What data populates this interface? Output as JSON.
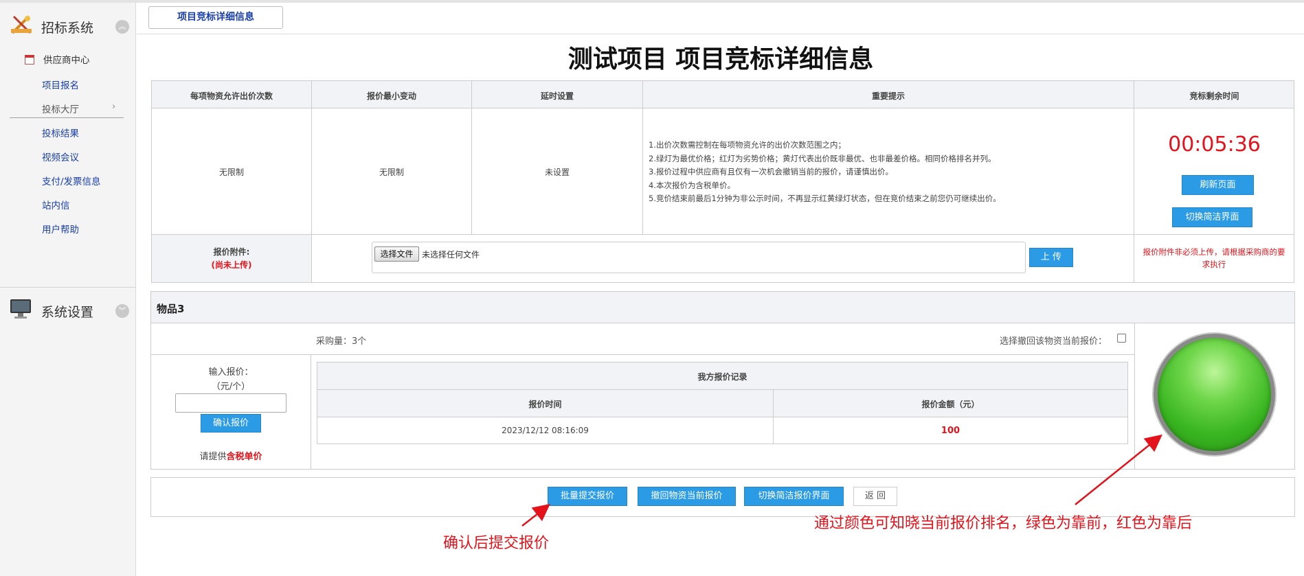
{
  "sidebar": {
    "header1": "招标系统",
    "sub_header": "供应商中心",
    "items": [
      "项目报名",
      "投标大厅",
      "投标结果",
      "视频会议",
      "支付/发票信息",
      "站内信",
      "用户帮助"
    ],
    "header2": "系统设置"
  },
  "tab": {
    "label": "项目竞标详细信息"
  },
  "page_title": "测试项目 项目竞标详细信息",
  "info_table": {
    "headers": [
      "每项物资允许出价次数",
      "报价最小变动",
      "延时设置",
      "重要提示",
      "竞标剩余时间"
    ],
    "values": [
      "无限制",
      "无限制",
      "未设置"
    ],
    "notes": [
      "1.出价次数需控制在每项物资允许的出价次数范围之内；",
      "2.绿灯为最优价格；红灯为劣势价格；黄灯代表出价既非最优、也非最差价格。相同价格排名并列。",
      "3.报价过程中供应商有且仅有一次机会撤销当前的报价，请谨慎出价。",
      "4.本次报价为含税单价。",
      "5.竞价结束前最后1分钟为非公示时间，不再显示红黄绿灯状态，但在竞价结束之前您仍可继续出价。"
    ],
    "timer": "00:05:36",
    "refresh_btn": "刷新页面",
    "switch_btn": "切换简洁界面"
  },
  "attachment": {
    "label": "报价附件:",
    "status": "(尚未上传)",
    "file_btn": "选择文件",
    "file_none": "未选择任何文件",
    "upload_btn": "上 传",
    "hint": "报价附件非必须上传，请根据采购商的要求执行"
  },
  "item": {
    "name": "物品3",
    "quantity": "采购量：3个",
    "withdraw_label": "选择撤回该物资当前报价：",
    "withdraw_checked": false,
    "input_label": "输入报价：",
    "input_unit": "（元/个）",
    "input_value": "",
    "confirm_btn": "确认报价",
    "tip_prefix": "请提供",
    "tip_emph": "含税单价",
    "record_title": "我方报价记录",
    "record_headers": [
      "报价时间",
      "报价金额（元）"
    ],
    "records": [
      {
        "time": "2023/12/12 08:16:09",
        "amount": "100"
      }
    ],
    "light_status": "green"
  },
  "actions": {
    "batch_submit": "批量提交报价",
    "withdraw": "撤回物资当前报价",
    "switch_simple": "切换简洁报价界面",
    "back": "返 回"
  },
  "annotations": {
    "left": "确认后提交报价",
    "right": "通过颜色可知晓当前报价排名，绿色为靠前，红色为靠后"
  },
  "colors": {
    "accent_blue": "#2b9be6",
    "alert_red": "#e4131b",
    "link_blue": "#1a3fa8"
  }
}
